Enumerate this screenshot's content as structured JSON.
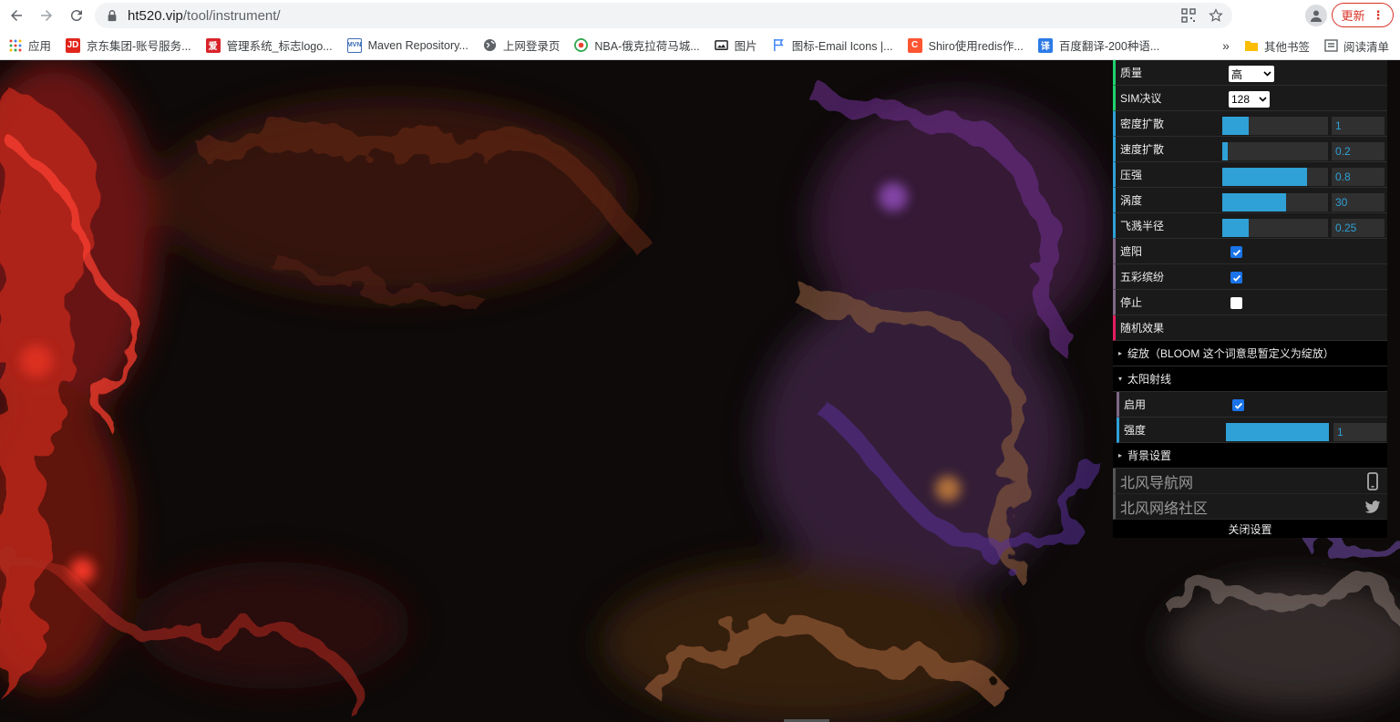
{
  "browser": {
    "url_host": "ht520.vip",
    "url_path": "/tool/instrument/",
    "update_label": "更新"
  },
  "bookmarks": [
    {
      "label": "应用",
      "icon": "apps-grid-icon",
      "color": "#ea4335"
    },
    {
      "label": "京东集团-账号服务...",
      "icon": "jd-icon",
      "color": "#e1251b"
    },
    {
      "label": "管理系统_标志logo...",
      "icon": "logo-site-icon",
      "color": "#d8232a"
    },
    {
      "label": "Maven Repository...",
      "icon": "maven-icon",
      "color": "#3d6db4"
    },
    {
      "label": "上网登录页",
      "icon": "globe-icon",
      "color": "#5f6368"
    },
    {
      "label": "NBA-俄克拉荷马城...",
      "icon": "nba-icon",
      "color": "#34a853"
    },
    {
      "label": "图片",
      "icon": "image-icon",
      "color": "#202124"
    },
    {
      "label": "图标-Email Icons |...",
      "icon": "flag-icon",
      "color": "#4285f4"
    },
    {
      "label": "Shiro使用redis作...",
      "icon": "c-site-icon",
      "color": "#fc5531"
    },
    {
      "label": "百度翻译-200种语...",
      "icon": "translate-icon",
      "color": "#2c7ae6"
    }
  ],
  "bookmarks_right": {
    "overflow": "»",
    "other": "其他书签",
    "reading": "阅读清单"
  },
  "gui": {
    "quality": {
      "label": "质量",
      "value": "高"
    },
    "sim_res": {
      "label": "SIM决议",
      "value": "128"
    },
    "density": {
      "label": "密度扩散",
      "value": "1",
      "fill": 0.25
    },
    "velocity": {
      "label": "速度扩散",
      "value": "0.2",
      "fill": 0.05
    },
    "pressure": {
      "label": "压强",
      "value": "0.8",
      "fill": 0.8
    },
    "curl": {
      "label": "涡度",
      "value": "30",
      "fill": 0.6
    },
    "splat": {
      "label": "飞溅半径",
      "value": "0.25",
      "fill": 0.25
    },
    "shading": {
      "label": "遮阳",
      "checked": true
    },
    "colorful": {
      "label": "五彩缤纷",
      "checked": true
    },
    "paused": {
      "label": "停止",
      "checked": false
    },
    "random": {
      "label": "随机效果"
    },
    "bloom_folder": "绽放（BLOOM 这个词意思暂定义为绽放）",
    "sunrays_folder": "太阳射线",
    "sun_enable": {
      "label": "启用",
      "checked": true
    },
    "sun_weight": {
      "label": "强度",
      "value": "1",
      "fill": 1.0
    },
    "background_folder": "背景设置",
    "link1": "北风导航网",
    "link2": "北风网络社区",
    "close": "关闭设置"
  },
  "colors": {
    "accent": "#2fa1d6",
    "panel_bg": "#1a1a1a",
    "func": "#e61d5f",
    "bool": "#806787"
  }
}
